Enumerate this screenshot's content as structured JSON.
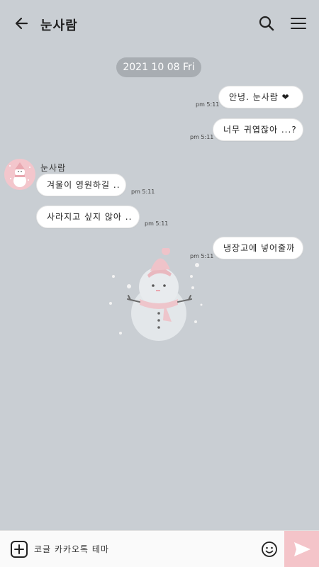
{
  "header": {
    "title": "눈사람"
  },
  "date_divider": "2021 10 08 Fri",
  "messages": {
    "m1": {
      "text": "안녕. 눈사람 ❤",
      "time": "pm 5:11"
    },
    "m2": {
      "text": "너무 귀엽잖아 ...?",
      "time": "pm 5:11"
    },
    "sender_name": "눈사람",
    "m3": {
      "text": "겨울이 영원하길 ..",
      "time": "pm 5:11"
    },
    "m4": {
      "text": "사라지고 싶지 않아 ..",
      "time": "pm 5:11"
    },
    "m5": {
      "text": "냉장고에 넣어줄까",
      "time": "pm 5:11"
    }
  },
  "input": {
    "placeholder": "코글 카카오톡 테마"
  },
  "colors": {
    "background": "#c9ced3",
    "accent_pink": "#f4c4c9",
    "date_pill": "#a8adb2"
  },
  "icons": [
    "back-arrow-icon",
    "search-icon",
    "menu-icon",
    "add-icon",
    "emoji-icon",
    "send-icon"
  ]
}
